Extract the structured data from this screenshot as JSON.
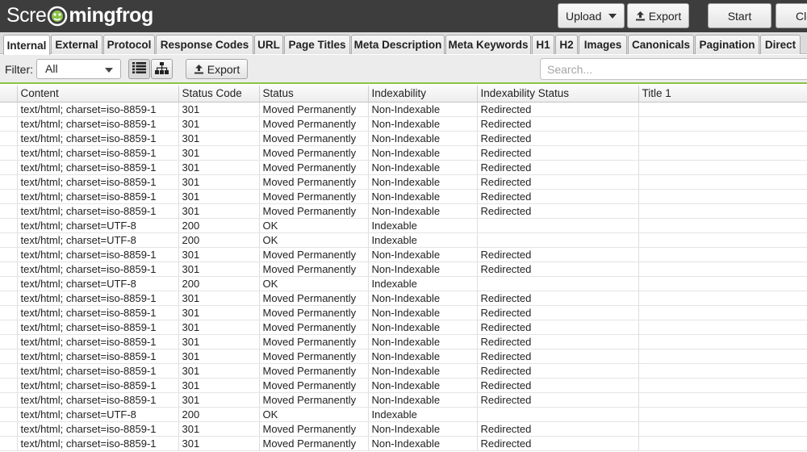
{
  "app": {
    "logo_text_start": "Scre",
    "logo_text_end": "mingfrog",
    "logo_icon": "frog-icon"
  },
  "toolbar": {
    "upload_label": "Upload",
    "export_label": "Export",
    "start_label": "Start",
    "clear_label": "Cle"
  },
  "tabs": [
    {
      "label": "Internal",
      "active": true
    },
    {
      "label": "External"
    },
    {
      "label": "Protocol"
    },
    {
      "label": "Response Codes"
    },
    {
      "label": "URL"
    },
    {
      "label": "Page Titles"
    },
    {
      "label": "Meta Description"
    },
    {
      "label": "Meta Keywords"
    },
    {
      "label": "H1"
    },
    {
      "label": "H2"
    },
    {
      "label": "Images"
    },
    {
      "label": "Canonicals"
    },
    {
      "label": "Pagination"
    },
    {
      "label": "Direct"
    }
  ],
  "filter": {
    "label": "Filter:",
    "selected": "All",
    "export_label": "Export",
    "search_placeholder": "Search..."
  },
  "colors": {
    "accent_green": "#8cc24a",
    "header_bg": "#3d3d3d"
  },
  "table": {
    "columns": [
      "",
      "Content",
      "Status Code",
      "Status",
      "Indexability",
      "Indexability Status",
      "Title 1"
    ],
    "rows": [
      [
        "text/html; charset=iso-8859-1",
        "301",
        "Moved Permanently",
        "Non-Indexable",
        "Redirected",
        ""
      ],
      [
        "text/html; charset=iso-8859-1",
        "301",
        "Moved Permanently",
        "Non-Indexable",
        "Redirected",
        ""
      ],
      [
        "text/html; charset=iso-8859-1",
        "301",
        "Moved Permanently",
        "Non-Indexable",
        "Redirected",
        ""
      ],
      [
        "text/html; charset=iso-8859-1",
        "301",
        "Moved Permanently",
        "Non-Indexable",
        "Redirected",
        ""
      ],
      [
        "text/html; charset=iso-8859-1",
        "301",
        "Moved Permanently",
        "Non-Indexable",
        "Redirected",
        ""
      ],
      [
        "text/html; charset=iso-8859-1",
        "301",
        "Moved Permanently",
        "Non-Indexable",
        "Redirected",
        ""
      ],
      [
        "text/html; charset=iso-8859-1",
        "301",
        "Moved Permanently",
        "Non-Indexable",
        "Redirected",
        ""
      ],
      [
        "text/html; charset=iso-8859-1",
        "301",
        "Moved Permanently",
        "Non-Indexable",
        "Redirected",
        ""
      ],
      [
        "text/html; charset=UTF-8",
        "200",
        "OK",
        "Indexable",
        "",
        ""
      ],
      [
        "text/html; charset=UTF-8",
        "200",
        "OK",
        "Indexable",
        "",
        ""
      ],
      [
        "text/html; charset=iso-8859-1",
        "301",
        "Moved Permanently",
        "Non-Indexable",
        "Redirected",
        ""
      ],
      [
        "text/html; charset=iso-8859-1",
        "301",
        "Moved Permanently",
        "Non-Indexable",
        "Redirected",
        ""
      ],
      [
        "text/html; charset=UTF-8",
        "200",
        "OK",
        "Indexable",
        "",
        ""
      ],
      [
        "text/html; charset=iso-8859-1",
        "301",
        "Moved Permanently",
        "Non-Indexable",
        "Redirected",
        ""
      ],
      [
        "text/html; charset=iso-8859-1",
        "301",
        "Moved Permanently",
        "Non-Indexable",
        "Redirected",
        ""
      ],
      [
        "text/html; charset=iso-8859-1",
        "301",
        "Moved Permanently",
        "Non-Indexable",
        "Redirected",
        ""
      ],
      [
        "text/html; charset=iso-8859-1",
        "301",
        "Moved Permanently",
        "Non-Indexable",
        "Redirected",
        ""
      ],
      [
        "text/html; charset=iso-8859-1",
        "301",
        "Moved Permanently",
        "Non-Indexable",
        "Redirected",
        ""
      ],
      [
        "text/html; charset=iso-8859-1",
        "301",
        "Moved Permanently",
        "Non-Indexable",
        "Redirected",
        ""
      ],
      [
        "text/html; charset=iso-8859-1",
        "301",
        "Moved Permanently",
        "Non-Indexable",
        "Redirected",
        ""
      ],
      [
        "text/html; charset=iso-8859-1",
        "301",
        "Moved Permanently",
        "Non-Indexable",
        "Redirected",
        ""
      ],
      [
        "text/html; charset=UTF-8",
        "200",
        "OK",
        "Indexable",
        "",
        ""
      ],
      [
        "text/html; charset=iso-8859-1",
        "301",
        "Moved Permanently",
        "Non-Indexable",
        "Redirected",
        ""
      ],
      [
        "text/html; charset=iso-8859-1",
        "301",
        "Moved Permanently",
        "Non-Indexable",
        "Redirected",
        ""
      ]
    ]
  }
}
